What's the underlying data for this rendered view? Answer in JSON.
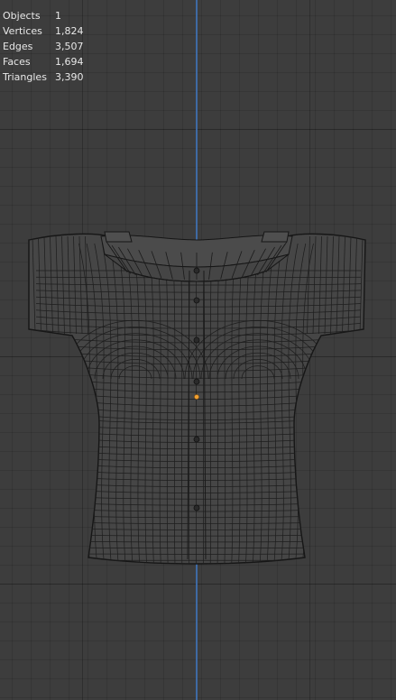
{
  "viewport": {
    "stats": [
      {
        "label": "Objects",
        "value": "1"
      },
      {
        "label": "Vertices",
        "value": "1,824"
      },
      {
        "label": "Edges",
        "value": "3,507"
      },
      {
        "label": "Faces",
        "value": "1,694"
      },
      {
        "label": "Triangles",
        "value": "3,390"
      }
    ],
    "colors": {
      "background": "#3d3d3d",
      "z_axis": "#3f6fae",
      "wire": "#161616",
      "mesh_fill": "#464646",
      "origin": "#f0a030"
    },
    "object": "shirt-wireframe-mesh"
  }
}
